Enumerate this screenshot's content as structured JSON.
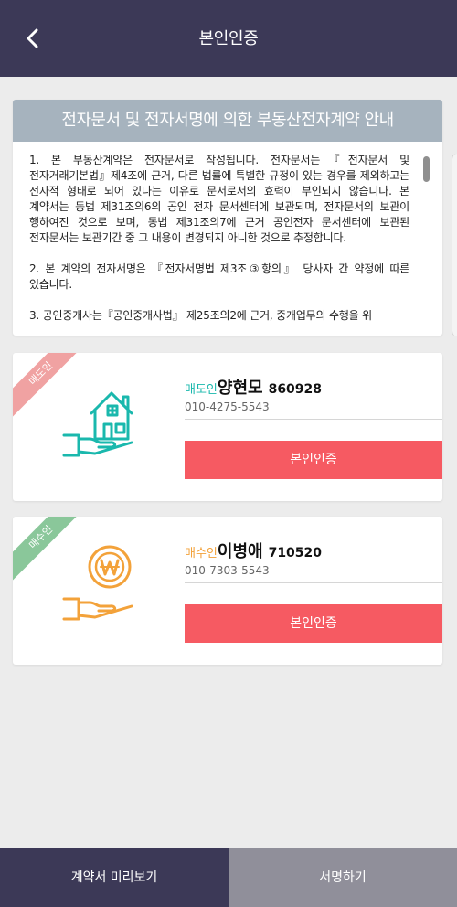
{
  "header": {
    "title": "본인인증",
    "back_icon": "chevron-left-icon"
  },
  "notice": {
    "title": "전자문서 및 전자서명에 의한 부동산전자계약 안내",
    "paragraphs": [
      "1. 본 부동산계약은 전자문서로 작성됩니다. 전자문서는『전자문서 및 전자거래기본법』제4조에 근거, 다른 법률에 특별한 규정이 있는 경우를 제외하고는 전자적 형태로 되어 있다는 이유로 문서로서의 효력이 부인되지 않습니다. 본 계약서는 동법 제31조의6의 공인 전자 문서센터에 보관되며, 전자문서의 보관이 행하여진 것으로 보며, 동법 제31조의7에 근거 공인전자 문서센터에 보관된 전자문서는 보관기간 중 그 내용이 변경되지 아니한 것으로 추정합니다.",
      "2. 본 계약의 전자서명은 『전자서명법 제3조③항의』 당사자 간 약정에 따른 있습니다.",
      "3. 공인중개사는『공인중개사법』 제25조의2에 근거, 중개업무의 수행을 위"
    ]
  },
  "seller": {
    "ribbon": "매도인",
    "role": "매도인",
    "name": "양현모",
    "code": "860928",
    "phone": "010-4275-5543",
    "button": "본인인증",
    "icon": "house-in-hand-icon",
    "accent": "#1ab8ad"
  },
  "buyer": {
    "ribbon": "매수인",
    "role": "매수인",
    "name": "이병애",
    "code": "710520",
    "phone": "010-7303-5543",
    "button": "본인인증",
    "icon": "won-coin-in-hand-icon",
    "accent": "#f3a23a"
  },
  "footer": {
    "preview": "계약서 미리보기",
    "sign": "서명하기"
  },
  "colors": {
    "header_bg": "#3c3957",
    "auth_button": "#f65a62",
    "seller_ribbon": "#f0a2a2",
    "buyer_ribbon": "#8ac79a",
    "sign_button": "#908f9a"
  }
}
